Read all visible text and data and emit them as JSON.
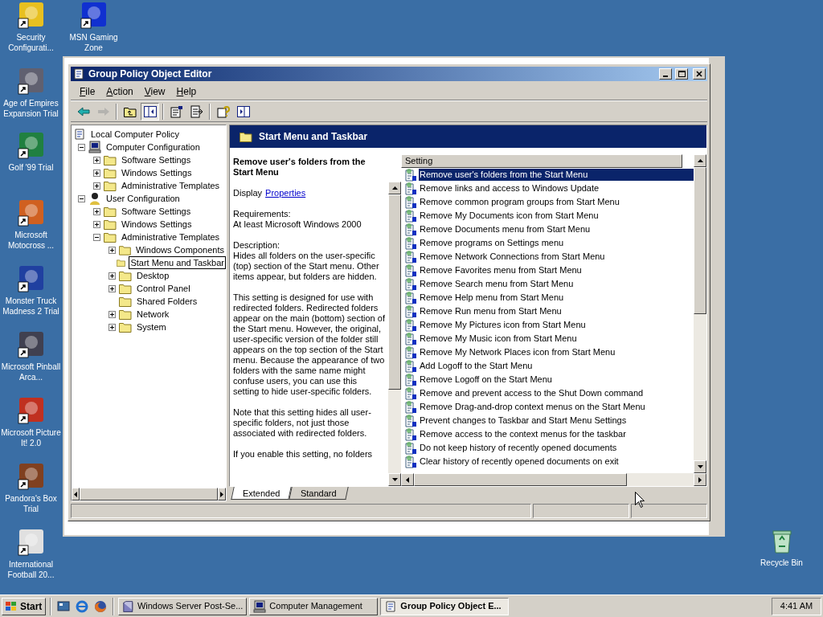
{
  "desktop_icons": [
    {
      "label": "Security Configurati..."
    },
    {
      "label": "MSN Gaming Zone"
    },
    {
      "label": "Age of Empires Expansion Trial"
    },
    {
      "label": "Golf '99 Trial"
    },
    {
      "label": "Microsoft Motocross ..."
    },
    {
      "label": "Monster Truck Madness 2 Trial"
    },
    {
      "label": "Microsoft Pinball Arca..."
    },
    {
      "label": "Microsoft Picture It! 2.0"
    },
    {
      "label": "Pandora's Box Trial"
    },
    {
      "label": "International Football 20..."
    },
    {
      "label": "Recycle Bin"
    }
  ],
  "window": {
    "title": "Group Policy Object Editor",
    "menu": [
      "File",
      "Action",
      "View",
      "Help"
    ],
    "toolbar": [
      {
        "kind": "back",
        "disabled": false,
        "pressed": false
      },
      {
        "kind": "forward",
        "disabled": true,
        "pressed": false
      },
      {
        "kind": "up",
        "disabled": false,
        "pressed": false
      },
      {
        "kind": "tree",
        "disabled": false,
        "pressed": true
      },
      {
        "kind": "properties",
        "disabled": false,
        "pressed": false
      },
      {
        "kind": "export",
        "disabled": false,
        "pressed": false
      },
      {
        "kind": "help",
        "disabled": false,
        "pressed": false
      },
      {
        "kind": "console",
        "disabled": false,
        "pressed": false
      }
    ],
    "tree": [
      {
        "label": "Local Computer Policy",
        "kind": "policy",
        "selected": false,
        "children": [
          {
            "label": "Computer Configuration",
            "kind": "computer",
            "expanded": true,
            "selected": false,
            "children": [
              {
                "label": "Software Settings",
                "kind": "folder",
                "expanded": false,
                "selected": false
              },
              {
                "label": "Windows Settings",
                "kind": "folder",
                "expanded": false,
                "selected": false
              },
              {
                "label": "Administrative Templates",
                "kind": "folder",
                "expanded": false,
                "selected": false
              }
            ]
          },
          {
            "label": "User Configuration",
            "kind": "user",
            "expanded": true,
            "selected": false,
            "children": [
              {
                "label": "Software Settings",
                "kind": "folder",
                "expanded": false,
                "selected": false
              },
              {
                "label": "Windows Settings",
                "kind": "folder",
                "expanded": false,
                "selected": false
              },
              {
                "label": "Administrative Templates",
                "kind": "folder",
                "expanded": true,
                "selected": false,
                "children": [
                  {
                    "label": "Windows Components",
                    "kind": "folder",
                    "expanded": false,
                    "selected": false
                  },
                  {
                    "label": "Start Menu and Taskbar",
                    "kind": "folder",
                    "selected": true
                  },
                  {
                    "label": "Desktop",
                    "kind": "folder",
                    "expanded": false,
                    "selected": false
                  },
                  {
                    "label": "Control Panel",
                    "kind": "folder",
                    "expanded": false,
                    "selected": false
                  },
                  {
                    "label": "Shared Folders",
                    "kind": "folder",
                    "selected": false
                  },
                  {
                    "label": "Network",
                    "kind": "folder",
                    "expanded": false,
                    "selected": false
                  },
                  {
                    "label": "System",
                    "kind": "folder",
                    "expanded": false,
                    "selected": false
                  }
                ]
              }
            ]
          }
        ]
      }
    ],
    "pane_title": "Start Menu and Taskbar",
    "description": {
      "title": "Remove user's folders from the Start Menu",
      "display_label": "Display",
      "display_link": "Properties",
      "requirements_label": "Requirements:",
      "requirements": "At least Microsoft Windows 2000",
      "description_label": "Description:",
      "paragraphs": [
        "Hides all folders on the user-specific (top) section of the Start menu. Other items appear, but folders are hidden.",
        "This setting is designed for use with redirected folders. Redirected folders appear on the main (bottom) section of the Start menu. However, the original, user-specific version of the folder still appears on the top section of the Start menu. Because the appearance of two folders with the same name might confuse users, you can use this setting to hide user-specific folders.",
        "Note that this setting hides all user-specific folders, not just those associated with redirected folders.",
        "If you enable this setting, no folders"
      ]
    },
    "settings_column": "Setting",
    "settings": [
      {
        "label": "Remove user's folders from the Start Menu",
        "selected": true
      },
      {
        "label": "Remove links and access to Windows Update",
        "selected": false
      },
      {
        "label": "Remove common program groups from Start Menu",
        "selected": false
      },
      {
        "label": "Remove My Documents icon from Start Menu",
        "selected": false
      },
      {
        "label": "Remove Documents menu from Start Menu",
        "selected": false
      },
      {
        "label": "Remove programs on Settings menu",
        "selected": false
      },
      {
        "label": "Remove Network Connections from Start Menu",
        "selected": false
      },
      {
        "label": "Remove Favorites menu from Start Menu",
        "selected": false
      },
      {
        "label": "Remove Search menu from Start Menu",
        "selected": false
      },
      {
        "label": "Remove Help menu from Start Menu",
        "selected": false
      },
      {
        "label": "Remove Run menu from Start Menu",
        "selected": false
      },
      {
        "label": "Remove My Pictures icon from Start Menu",
        "selected": false
      },
      {
        "label": "Remove My Music icon from Start Menu",
        "selected": false
      },
      {
        "label": "Remove My Network Places icon from Start Menu",
        "selected": false
      },
      {
        "label": "Add Logoff to the Start Menu",
        "selected": false
      },
      {
        "label": "Remove Logoff on the Start Menu",
        "selected": false
      },
      {
        "label": "Remove and prevent access to the Shut Down command",
        "selected": false
      },
      {
        "label": "Remove Drag-and-drop context menus on the Start Menu",
        "selected": false
      },
      {
        "label": "Prevent changes to Taskbar and Start Menu Settings",
        "selected": false
      },
      {
        "label": "Remove access to the context menus for the taskbar",
        "selected": false
      },
      {
        "label": "Do not keep history of recently opened documents",
        "selected": false
      },
      {
        "label": "Clear history of recently opened documents on exit",
        "selected": false
      }
    ],
    "tabs": [
      {
        "label": "Extended",
        "selected": true
      },
      {
        "label": "Standard",
        "selected": false
      }
    ]
  },
  "taskbar": {
    "start": "Start",
    "quick_launch": [
      {
        "kind": "desktop"
      },
      {
        "kind": "ie"
      },
      {
        "kind": "firefox"
      }
    ],
    "tasks": [
      {
        "label": "Windows Server Post-Se...",
        "kind": "setup",
        "selected": false
      },
      {
        "label": "Computer Management",
        "kind": "computer",
        "selected": false
      },
      {
        "label": "Group Policy Object E...",
        "kind": "policy",
        "selected": true
      }
    ],
    "clock": "4:41 AM"
  }
}
